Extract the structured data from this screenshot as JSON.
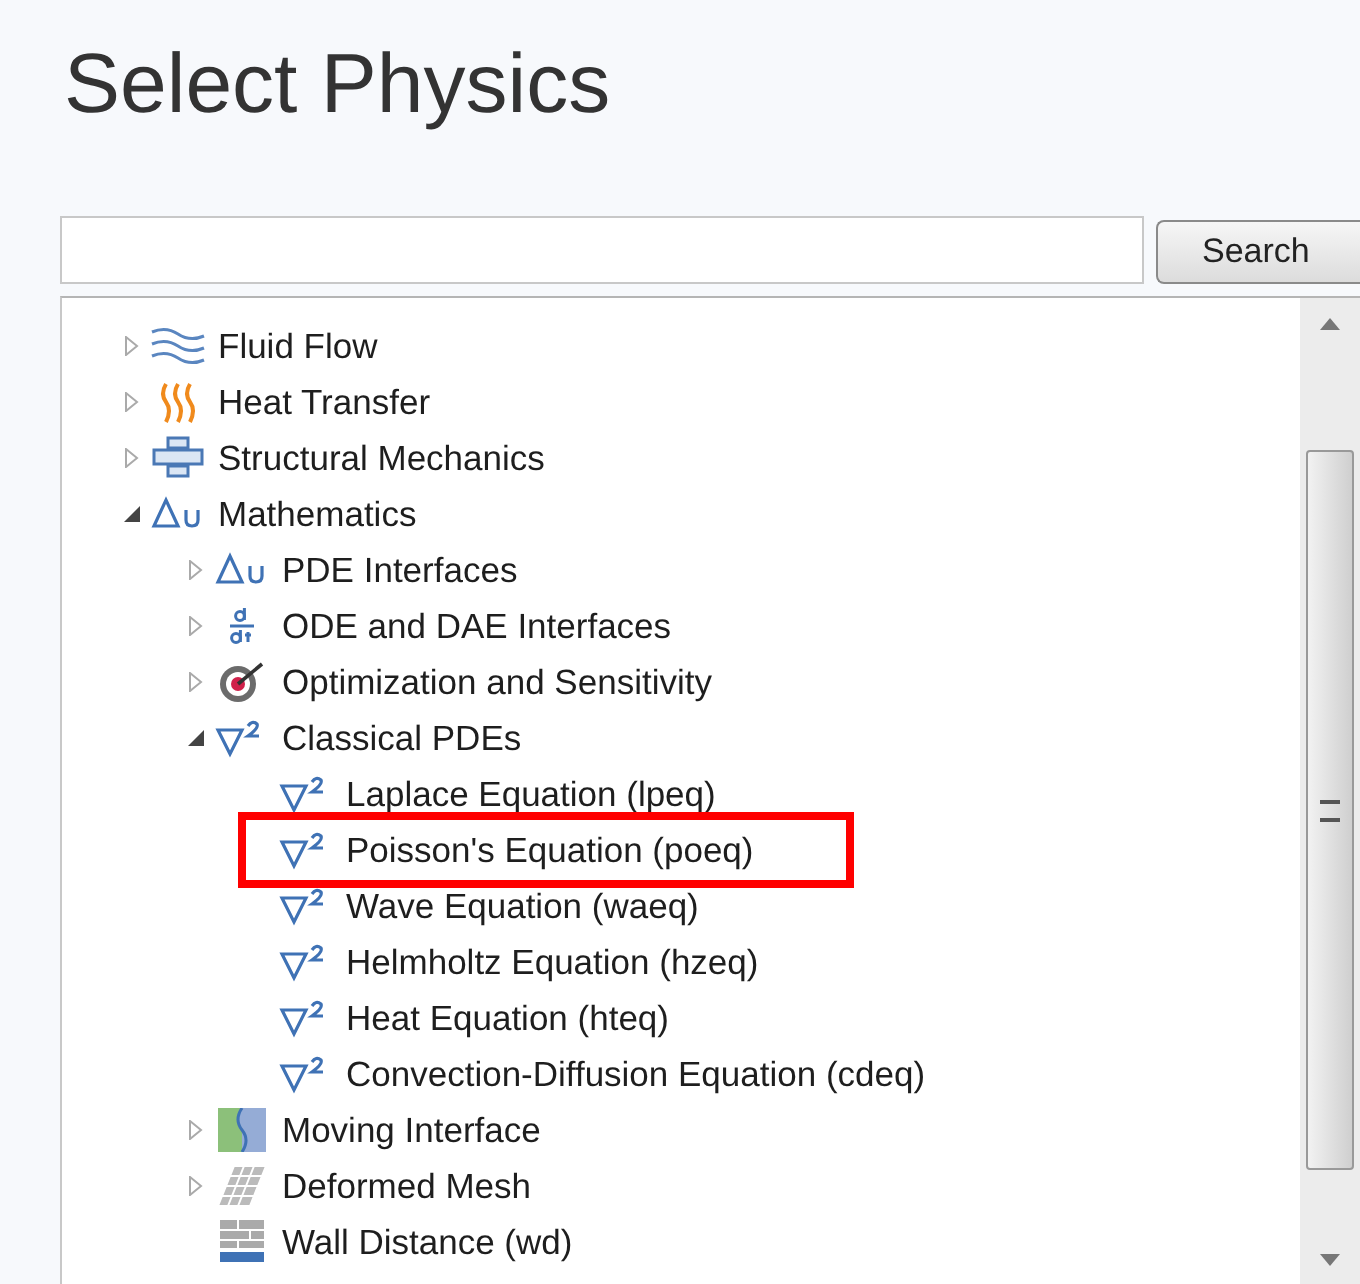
{
  "title": "Select Physics",
  "search": {
    "button": "Search"
  },
  "tree": [
    {
      "label": "Fluid Flow",
      "kind": "waves",
      "expanded": false
    },
    {
      "label": "Heat Transfer",
      "kind": "flames",
      "expanded": false
    },
    {
      "label": "Structural Mechanics",
      "kind": "structure",
      "expanded": false
    },
    {
      "label": "Mathematics",
      "kind": "delta",
      "expanded": true,
      "children": [
        {
          "label": "PDE Interfaces",
          "kind": "delta",
          "expanded": false
        },
        {
          "label": "ODE and DAE Interfaces",
          "kind": "derivative",
          "expanded": false
        },
        {
          "label": "Optimization and Sensitivity",
          "kind": "target",
          "expanded": false
        },
        {
          "label": "Classical PDEs",
          "kind": "nabla",
          "expanded": true,
          "children": [
            {
              "label": "Laplace Equation (lpeq)",
              "kind": "nabla"
            },
            {
              "label": "Poisson's Equation (poeq)",
              "kind": "nabla",
              "highlighted": true
            },
            {
              "label": "Wave Equation (waeq)",
              "kind": "nabla"
            },
            {
              "label": "Helmholtz Equation (hzeq)",
              "kind": "nabla"
            },
            {
              "label": "Heat Equation (hteq)",
              "kind": "nabla"
            },
            {
              "label": "Convection-Diffusion Equation (cdeq)",
              "kind": "nabla"
            }
          ]
        },
        {
          "label": "Moving Interface",
          "kind": "moving",
          "expanded": false
        },
        {
          "label": "Deformed Mesh",
          "kind": "mesh",
          "expanded": false
        },
        {
          "label": "Wall Distance (wd)",
          "kind": "wall"
        }
      ]
    }
  ]
}
